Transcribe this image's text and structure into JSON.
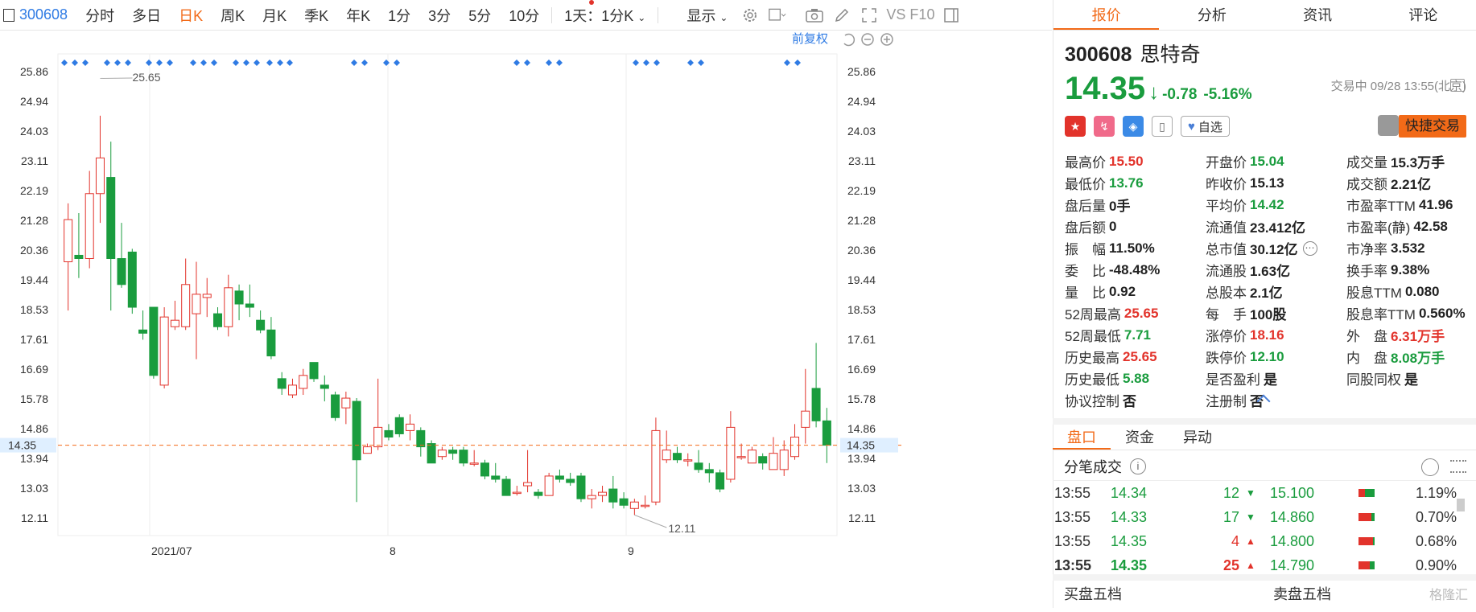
{
  "toolbar": {
    "code": "300608",
    "periods": [
      "分时",
      "多日",
      "日K",
      "周K",
      "月K",
      "季K",
      "年K",
      "1分",
      "3分",
      "5分",
      "10分"
    ],
    "active_period": "日K",
    "interval_select": "1天：1分K",
    "display_label": "显示",
    "text_icon_f10": "VS F10"
  },
  "chart": {
    "adjust_label": "前复权",
    "y_ticks": [
      "25.86",
      "24.94",
      "24.03",
      "23.11",
      "22.19",
      "21.28",
      "20.36",
      "19.44",
      "18.53",
      "17.61",
      "16.69",
      "15.78",
      "14.86",
      "13.94",
      "13.03",
      "12.11"
    ],
    "current_price": "14.35",
    "max_label": "25.65",
    "min_label": "12.11",
    "x_labels": [
      "2021/07",
      "8",
      "9"
    ]
  },
  "chart_data": {
    "type": "candlestick",
    "ylim": [
      12.11,
      25.86
    ],
    "x_labels": [
      "2021/07",
      "8",
      "9"
    ],
    "max_annotation": 25.65,
    "min_annotation": 12.11,
    "last_price": 14.35,
    "candles": [
      [
        20.0,
        21.3,
        21.8,
        18.5
      ],
      [
        20.2,
        20.1,
        21.5,
        19.5
      ],
      [
        20.1,
        22.1,
        22.8,
        19.8
      ],
      [
        22.1,
        23.2,
        24.5,
        21.2
      ],
      [
        22.6,
        20.1,
        23.7,
        18.5
      ],
      [
        20.1,
        19.3,
        21.2,
        19.2
      ],
      [
        20.3,
        18.6,
        20.4,
        18.4
      ],
      [
        17.9,
        17.8,
        18.5,
        17.6
      ],
      [
        18.6,
        16.5,
        18.6,
        16.4
      ],
      [
        16.2,
        18.3,
        18.6,
        16.1
      ],
      [
        18.0,
        18.2,
        18.8,
        17.9
      ],
      [
        18.0,
        19.3,
        20.1,
        17.9
      ],
      [
        18.4,
        19.0,
        20.0,
        17.0
      ],
      [
        18.9,
        19.0,
        19.5,
        18.3
      ],
      [
        18.4,
        18.0,
        18.6,
        17.9
      ],
      [
        18.0,
        19.2,
        19.6,
        17.7
      ],
      [
        19.1,
        18.7,
        19.3,
        18.2
      ],
      [
        18.7,
        18.6,
        19.3,
        18.3
      ],
      [
        18.2,
        17.9,
        18.5,
        17.8
      ],
      [
        17.9,
        17.1,
        18.3,
        17.0
      ],
      [
        16.4,
        16.1,
        16.6,
        15.9
      ],
      [
        15.9,
        16.2,
        16.4,
        15.8
      ],
      [
        16.1,
        16.5,
        16.7,
        15.9
      ],
      [
        16.9,
        16.4,
        16.9,
        16.3
      ],
      [
        16.2,
        16.1,
        16.5,
        15.7
      ],
      [
        15.9,
        15.2,
        16.0,
        15.1
      ],
      [
        15.5,
        15.8,
        16.0,
        15.0
      ],
      [
        15.7,
        13.9,
        15.8,
        12.6
      ],
      [
        14.1,
        14.3,
        14.4,
        14.1
      ],
      [
        14.3,
        14.9,
        16.4,
        14.2
      ],
      [
        14.8,
        14.6,
        15.0,
        14.5
      ],
      [
        15.2,
        14.7,
        15.3,
        14.6
      ],
      [
        14.8,
        15.0,
        15.3,
        14.5
      ],
      [
        14.8,
        14.3,
        14.9,
        14.0
      ],
      [
        14.4,
        13.8,
        14.5,
        13.8
      ],
      [
        14.0,
        14.2,
        14.3,
        13.9
      ],
      [
        14.2,
        14.1,
        14.3,
        13.9
      ],
      [
        14.2,
        13.8,
        14.3,
        13.7
      ],
      [
        13.8,
        13.8,
        14.2,
        13.7
      ],
      [
        13.8,
        13.4,
        13.9,
        13.3
      ],
      [
        13.4,
        13.3,
        13.8,
        13.2
      ],
      [
        13.3,
        12.8,
        13.4,
        12.8
      ],
      [
        12.9,
        12.9,
        13.1,
        12.8
      ],
      [
        13.1,
        13.2,
        14.2,
        12.9
      ],
      [
        12.9,
        12.8,
        13.0,
        12.7
      ],
      [
        12.8,
        13.4,
        13.5,
        12.8
      ],
      [
        13.4,
        13.3,
        13.6,
        13.2
      ],
      [
        13.3,
        13.2,
        13.5,
        13.1
      ],
      [
        13.4,
        12.7,
        13.5,
        12.6
      ],
      [
        12.7,
        12.8,
        13.0,
        12.4
      ],
      [
        12.8,
        12.9,
        13.1,
        12.6
      ],
      [
        13.0,
        12.6,
        13.4,
        12.4
      ],
      [
        12.7,
        12.5,
        12.9,
        12.4
      ],
      [
        12.4,
        12.6,
        12.7,
        12.2
      ],
      [
        12.5,
        12.5,
        12.8,
        12.4
      ],
      [
        12.6,
        14.8,
        15.2,
        12.5
      ],
      [
        13.9,
        14.2,
        14.8,
        13.8
      ],
      [
        14.1,
        13.9,
        14.3,
        13.8
      ],
      [
        13.9,
        13.9,
        14.1,
        13.7
      ],
      [
        13.8,
        13.6,
        14.2,
        13.5
      ],
      [
        13.6,
        13.5,
        13.8,
        13.2
      ],
      [
        13.5,
        13.0,
        13.6,
        12.9
      ],
      [
        13.3,
        14.9,
        15.4,
        13.2
      ],
      [
        14.0,
        14.0,
        14.4,
        13.9
      ],
      [
        13.8,
        14.2,
        14.3,
        13.8
      ],
      [
        14.0,
        13.8,
        14.1,
        13.6
      ],
      [
        13.6,
        14.1,
        14.6,
        13.6
      ],
      [
        13.6,
        14.2,
        14.5,
        13.4
      ],
      [
        14.0,
        14.6,
        15.0,
        13.9
      ],
      [
        14.9,
        15.4,
        16.7,
        14.4
      ],
      [
        16.1,
        15.1,
        17.5,
        14.9
      ],
      [
        15.1,
        14.35,
        15.5,
        13.8
      ]
    ],
    "top_markers_groups": [
      3,
      3,
      3,
      3,
      3,
      2,
      1,
      2,
      2,
      2,
      2,
      3,
      2,
      2,
      2
    ],
    "horizontal_line": 14.35
  },
  "quote_tabs": [
    "报价",
    "分析",
    "资讯",
    "评论"
  ],
  "quote": {
    "code": "300608",
    "name": "思特奇",
    "price": "14.35",
    "arrow": "↓",
    "change": "-0.78",
    "pct": "-5.16%",
    "time": "交易中 09/28 13:55(北京)",
    "fav_label": "自选",
    "quick_trade": "快捷交易"
  },
  "metrics": [
    {
      "label": "最高价",
      "value": "15.50",
      "color": "red"
    },
    {
      "label": "开盘价",
      "value": "15.04",
      "color": "grn"
    },
    {
      "label": "成交量",
      "value": "15.3万手",
      "color": ""
    },
    {
      "label": "最低价",
      "value": "13.76",
      "color": "grn"
    },
    {
      "label": "昨收价",
      "value": "15.13",
      "color": ""
    },
    {
      "label": "成交额",
      "value": "2.21亿",
      "color": ""
    },
    {
      "label": "盘后量",
      "value": "0手",
      "color": ""
    },
    {
      "label": "平均价",
      "value": "14.42",
      "color": "grn"
    },
    {
      "label": "市盈率TTM",
      "value": "41.96",
      "color": ""
    },
    {
      "label": "盘后额",
      "value": "0",
      "color": ""
    },
    {
      "label": "流通值",
      "value": "23.412亿",
      "color": ""
    },
    {
      "label": "市盈率(静)",
      "value": "42.58",
      "color": ""
    },
    {
      "label": "振　幅",
      "value": "11.50%",
      "color": ""
    },
    {
      "label": "总市值",
      "value": "30.12亿",
      "color": ""
    },
    {
      "label": "市净率",
      "value": "3.532",
      "color": ""
    },
    {
      "label": "委　比",
      "value": "-48.48%",
      "color": ""
    },
    {
      "label": "流通股",
      "value": "1.63亿",
      "color": ""
    },
    {
      "label": "换手率",
      "value": "9.38%",
      "color": ""
    },
    {
      "label": "量　比",
      "value": "0.92",
      "color": ""
    },
    {
      "label": "总股本",
      "value": "2.1亿",
      "color": ""
    },
    {
      "label": "股息TTM",
      "value": "0.080",
      "color": ""
    },
    {
      "label": "52周最高",
      "value": "25.65",
      "color": "red"
    },
    {
      "label": "每　手",
      "value": "100股",
      "color": ""
    },
    {
      "label": "股息率TTM",
      "value": "0.560%",
      "color": ""
    },
    {
      "label": "52周最低",
      "value": "7.71",
      "color": "grn"
    },
    {
      "label": "涨停价",
      "value": "18.16",
      "color": "red"
    },
    {
      "label": "外　盘",
      "value": "6.31万手",
      "color": "red"
    },
    {
      "label": "历史最高",
      "value": "25.65",
      "color": "red"
    },
    {
      "label": "跌停价",
      "value": "12.10",
      "color": "grn"
    },
    {
      "label": "内　盘",
      "value": "8.08万手",
      "color": "grn"
    },
    {
      "label": "历史最低",
      "value": "5.88",
      "color": "grn"
    },
    {
      "label": "是否盈利",
      "value": "是",
      "color": ""
    },
    {
      "label": "同股同权",
      "value": "是",
      "color": ""
    },
    {
      "label": "协议控制",
      "value": "否",
      "color": ""
    },
    {
      "label": "注册制",
      "value": "否",
      "color": ""
    },
    {
      "label": "",
      "value": "",
      "color": ""
    }
  ],
  "panel_tabs": [
    "盘口",
    "资金",
    "异动"
  ],
  "ticks_title": "分笔成交",
  "ticks": [
    {
      "t": "13:55",
      "p": "14.34",
      "v": "12",
      "dir": "down"
    },
    {
      "t": "13:55",
      "p": "14.33",
      "v": "17",
      "dir": "down"
    },
    {
      "t": "13:55",
      "p": "14.35",
      "v": "4",
      "dir": "up"
    },
    {
      "t": "13:55",
      "p": "14.35",
      "v": "25",
      "dir": "up"
    }
  ],
  "dist": [
    {
      "p": "15.100",
      "pct": "1.19%",
      "r": 0.6
    },
    {
      "p": "14.860",
      "pct": "0.70%",
      "r": 0.2
    },
    {
      "p": "14.800",
      "pct": "0.68%",
      "r": 0.1
    },
    {
      "p": "14.790",
      "pct": "0.90%",
      "r": 0.3
    }
  ],
  "footer": {
    "buy": "买盘五档",
    "sell": "卖盘五档",
    "watermark": "格隆汇"
  },
  "colors": {
    "up": "#e2332b",
    "down": "#1a9c3e",
    "accent": "#f26a18",
    "marker": "#2f7be4"
  }
}
